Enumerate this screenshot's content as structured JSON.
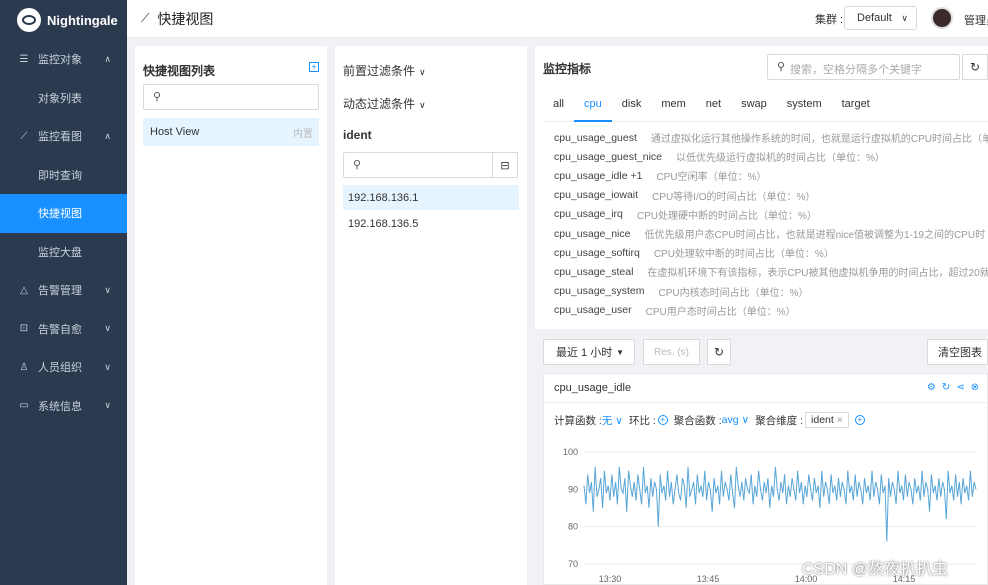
{
  "brand": "Nightingale",
  "sidebar": {
    "items": [
      {
        "label": "监控对象",
        "icon": "list-icon",
        "type": "group",
        "chev": "^"
      },
      {
        "label": "对象列表",
        "type": "sub"
      },
      {
        "label": "监控看图",
        "icon": "line-chart-icon",
        "type": "group",
        "chev": "^"
      },
      {
        "label": "即时查询",
        "type": "sub"
      },
      {
        "label": "快捷视图",
        "type": "sub",
        "active": true
      },
      {
        "label": "监控大盘",
        "type": "sub"
      },
      {
        "label": "告警管理",
        "icon": "alert-icon",
        "type": "group",
        "chev": "v"
      },
      {
        "label": "告警自愈",
        "icon": "heal-icon",
        "type": "group",
        "chev": "v"
      },
      {
        "label": "人员组织",
        "icon": "user-icon",
        "type": "group",
        "chev": "v"
      },
      {
        "label": "系统信息",
        "icon": "info-icon",
        "type": "group",
        "chev": "v"
      }
    ]
  },
  "header": {
    "title": "快捷视图",
    "cluster_label": "集群 :",
    "cluster_value": "Default",
    "user": "管理员"
  },
  "viewlist": {
    "title": "快捷视图列表",
    "item": "Host View",
    "item_tag": "内置"
  },
  "filters": {
    "prefilter": "前置过滤条件",
    "dynfilter": "动态过滤条件",
    "ident": "ident",
    "ips": [
      "192.168.136.1",
      "192.168.136.5"
    ]
  },
  "metrics": {
    "title": "监控指标",
    "search_placeholder": "搜索，空格分隔多个关键字",
    "tabs": [
      "all",
      "cpu",
      "disk",
      "mem",
      "net",
      "swap",
      "system",
      "target"
    ],
    "active_tab": "cpu",
    "items": [
      {
        "name": "cpu_usage_guest",
        "desc": "通过虚拟化运行其他操作系统的时间，也就是运行虚拟机的CPU时间占比（单"
      },
      {
        "name": "cpu_usage_guest_nice",
        "desc": "以低优先级运行虚拟机的时间占比（单位：%）"
      },
      {
        "name": "cpu_usage_idle  +1",
        "desc": "CPU空闲率（单位：%）"
      },
      {
        "name": "cpu_usage_iowait",
        "desc": "CPU等待I/O的时间占比（单位：%）"
      },
      {
        "name": "cpu_usage_irq",
        "desc": "CPU处理硬中断的时间占比（单位：%）"
      },
      {
        "name": "cpu_usage_nice",
        "desc": "低优先级用户态CPU时间占比，也就是进程nice值被调整为1-19之间的CPU时"
      },
      {
        "name": "cpu_usage_softirq",
        "desc": "CPU处理软中断的时间占比（单位：%）"
      },
      {
        "name": "cpu_usage_steal",
        "desc": "在虚拟机环境下有该指标，表示CPU被其他虚拟机争用的时间占比，超过20就"
      },
      {
        "name": "cpu_usage_system",
        "desc": "CPU内核态时间占比（单位：%）"
      },
      {
        "name": "cpu_usage_user",
        "desc": "CPU用户态时间占比（单位：%）"
      }
    ]
  },
  "toolbar": {
    "time": "最近 1 小时",
    "res": "Res. (s)",
    "clear": "清空图表"
  },
  "chart": {
    "title": "cpu_usage_idle",
    "calc_label": "计算函数 :",
    "calc_value": "无",
    "compare_label": "环比 :",
    "agg_label": "聚合函数 :",
    "agg_value": "avg",
    "dim_label": "聚合维度 :",
    "dim_chip": "ident"
  },
  "chart_data": {
    "type": "line",
    "title": "",
    "yticks": [
      70,
      80,
      90,
      100
    ],
    "ylim": [
      70,
      100
    ],
    "xticks": [
      "13:30",
      "13:45",
      "14:00",
      "14:15"
    ],
    "series": [
      {
        "color": "#58a6d8",
        "values": [
          91,
          86,
          94,
          89,
          92,
          84,
          96,
          88,
          90,
          93,
          85,
          95,
          89,
          91,
          87,
          94,
          88,
          92,
          86,
          96,
          90,
          89,
          93,
          84,
          95,
          91,
          88,
          92,
          87,
          94,
          90,
          86,
          96,
          89,
          91,
          85,
          93,
          88,
          92,
          90,
          80,
          94,
          89,
          91,
          87,
          95,
          88,
          92,
          86,
          90,
          94,
          89,
          87,
          93,
          91,
          85,
          96,
          88,
          90,
          92,
          86,
          94,
          89,
          91,
          88,
          95,
          87,
          92,
          90,
          84,
          93,
          89,
          91,
          86,
          95,
          88,
          92,
          90,
          87,
          94,
          89,
          85,
          96,
          91,
          88,
          92,
          87,
          93,
          90,
          89,
          94,
          86,
          91,
          88,
          95,
          90,
          87,
          92,
          89,
          93,
          85,
          91,
          88,
          96,
          90,
          87,
          92,
          89,
          94,
          86,
          91,
          88,
          93,
          90,
          87,
          95,
          89,
          92,
          86,
          91,
          88,
          94,
          90,
          87,
          93,
          89,
          91,
          85,
          95,
          88,
          92,
          90,
          86,
          94,
          89,
          91,
          87,
          93,
          88,
          92,
          90,
          86,
          95,
          89,
          91,
          87,
          94,
          88,
          92,
          90,
          86,
          93,
          89,
          91,
          87,
          95,
          88,
          92,
          90,
          86,
          94,
          89,
          91,
          76,
          93,
          88,
          92,
          90,
          86,
          95,
          89,
          91,
          87,
          94,
          88,
          92,
          90,
          86,
          93,
          89,
          91,
          87,
          95,
          88,
          92,
          90,
          84,
          94,
          89,
          91,
          87,
          93,
          88,
          92,
          90,
          82,
          95,
          89,
          91,
          87,
          94,
          88,
          92,
          86,
          93,
          89,
          91,
          87,
          95,
          88,
          92,
          90
        ]
      }
    ]
  },
  "watermark": "CSDN @熬夜扒扒虫"
}
